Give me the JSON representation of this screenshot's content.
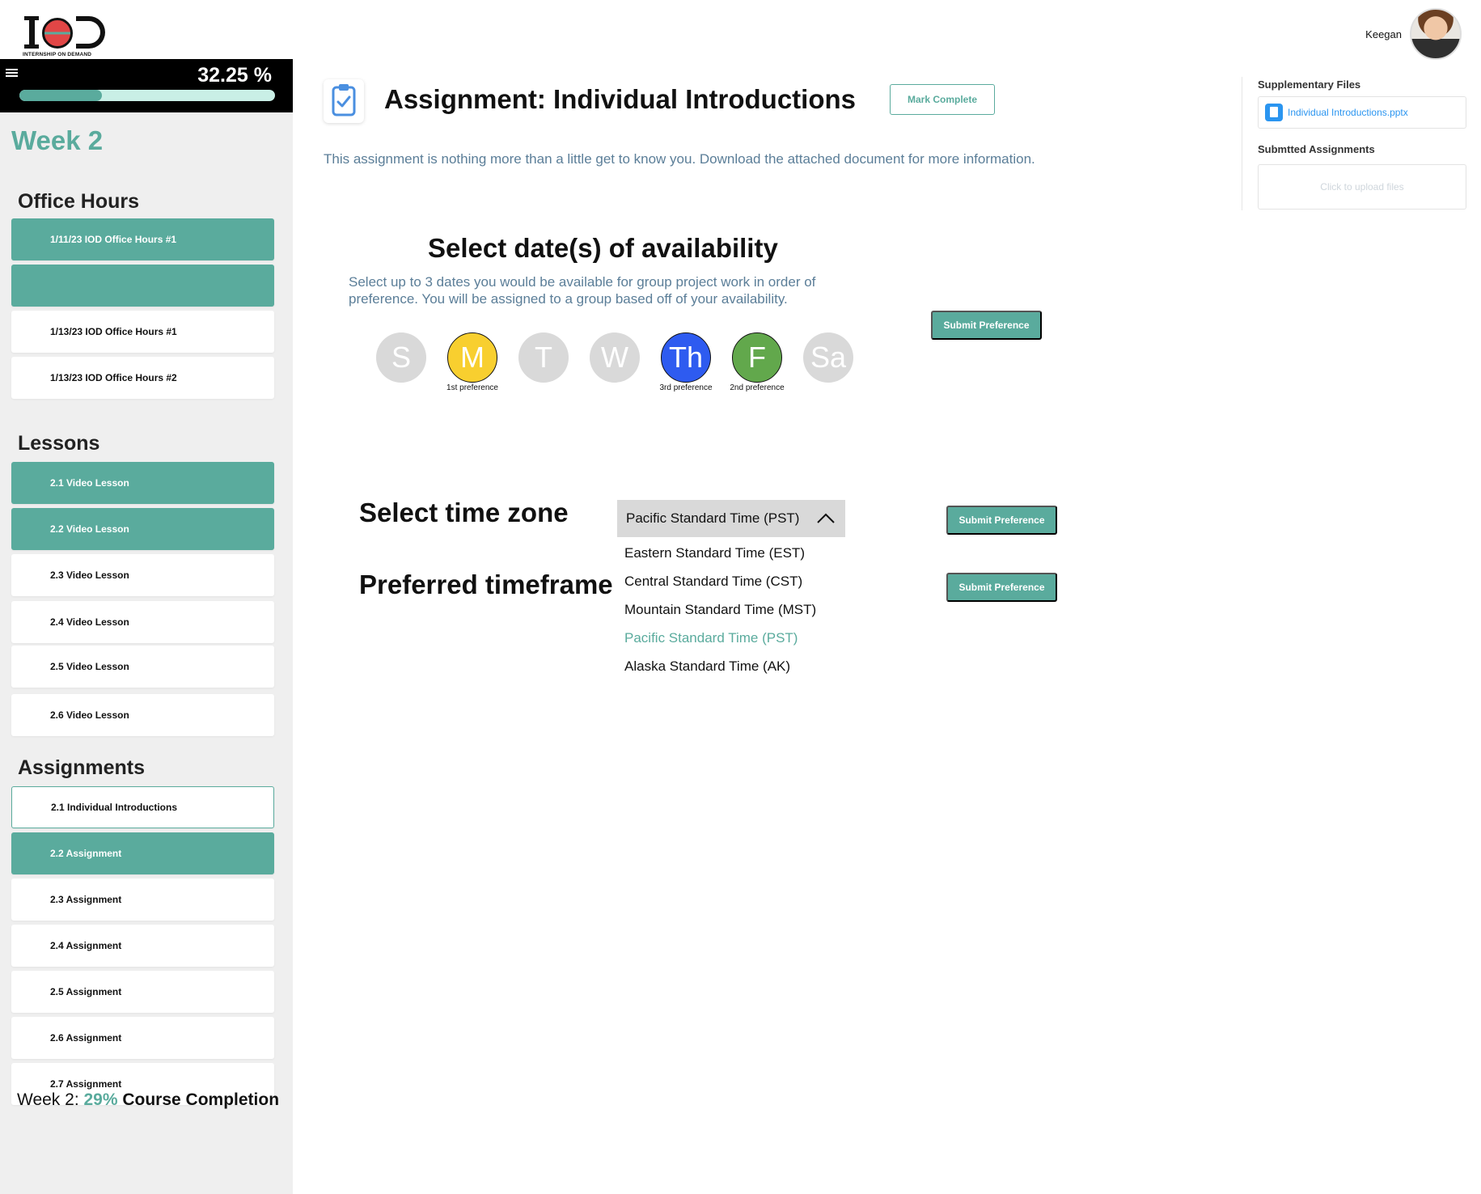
{
  "header": {
    "logo_text": "IOD",
    "logo_tagline": "INTERNSHIP ON DEMAND",
    "user_name": "Keegan"
  },
  "sidebar": {
    "progress_text": "32.25 %",
    "progress_value": 0.3225,
    "week_title": "Week 2",
    "office_hours_title": "Office Hours",
    "office_hours": [
      {
        "label": "1/11/23 IOD Office Hours #1",
        "state": "active"
      },
      {
        "label": "",
        "state": "active"
      },
      {
        "label": "1/13/23 IOD Office Hours #1",
        "state": "normal"
      },
      {
        "label": "1/13/23 IOD Office Hours #2",
        "state": "normal"
      }
    ],
    "lessons_title": "Lessons",
    "lessons": [
      {
        "label": "2.1 Video Lesson",
        "state": "active"
      },
      {
        "label": "2.2 Video Lesson",
        "state": "active"
      },
      {
        "label": "2.3 Video Lesson",
        "state": "normal"
      },
      {
        "label": "2.4 Video Lesson",
        "state": "normal"
      },
      {
        "label": "2.5 Video Lesson",
        "state": "normal"
      },
      {
        "label": "2.6 Video Lesson",
        "state": "normal"
      }
    ],
    "assignments_title": "Assignments",
    "assignments": [
      {
        "label": "2.1 Individual Introductions",
        "state": "current"
      },
      {
        "label": "2.2 Assignment",
        "state": "active"
      },
      {
        "label": "2.3 Assignment",
        "state": "normal"
      },
      {
        "label": "2.4 Assignment",
        "state": "normal"
      },
      {
        "label": "2.5 Assignment",
        "state": "normal"
      },
      {
        "label": "2.6 Assignment",
        "state": "normal"
      },
      {
        "label": "2.7 Assignment",
        "state": "normal"
      }
    ],
    "completion": {
      "prefix": "Week 2: ",
      "percent": "29%",
      "label": " Course Completion"
    }
  },
  "main": {
    "title": "Assignment: Individual Introductions",
    "mark_complete_label": "Mark Complete",
    "description": "This assignment is nothing more than a little get to know you. Download the attached document for more information.",
    "availability": {
      "title": "Select date(s) of availability",
      "description": "Select up to 3 dates you would be available for group project work in order of preference. You will be assigned to a group based off of your availability.",
      "days": [
        {
          "abbr": "S",
          "color": "#d9d9d9",
          "preference": ""
        },
        {
          "abbr": "M",
          "color": "#f8cf2f",
          "preference": "1st preference"
        },
        {
          "abbr": "T",
          "color": "#d9d9d9",
          "preference": ""
        },
        {
          "abbr": "W",
          "color": "#d9d9d9",
          "preference": ""
        },
        {
          "abbr": "Th",
          "color": "#2e5bf0",
          "preference": "3rd preference"
        },
        {
          "abbr": "F",
          "color": "#62a84c",
          "preference": "2nd preference"
        },
        {
          "abbr": "Sa",
          "color": "#d9d9d9",
          "preference": ""
        }
      ],
      "submit_label": "Submit Preference"
    },
    "timezone": {
      "title": "Select time zone",
      "selected": "Pacific Standard Time (PST)",
      "options": [
        {
          "label": "Eastern Standard Time (EST)",
          "selected": false
        },
        {
          "label": "Central Standard Time (CST)",
          "selected": false
        },
        {
          "label": "Mountain Standard Time (MST)",
          "selected": false
        },
        {
          "label": "Pacific Standard Time (PST)",
          "selected": true
        },
        {
          "label": "Alaska Standard Time (AK)",
          "selected": false
        }
      ],
      "submit_label": "Submit Preference"
    },
    "timeframe": {
      "title": "Preferred timeframe",
      "submit_label": "Submit Preference"
    }
  },
  "right_panel": {
    "supplementary_title": "Supplementary Files",
    "file_name": "Individual Introductions.pptx",
    "submitted_title": "Submtted Assignments",
    "upload_placeholder": "Click to upload files"
  },
  "colors": {
    "accent": "#5aab9d",
    "muted_text": "#5b7e98",
    "link": "#2b95f0"
  }
}
